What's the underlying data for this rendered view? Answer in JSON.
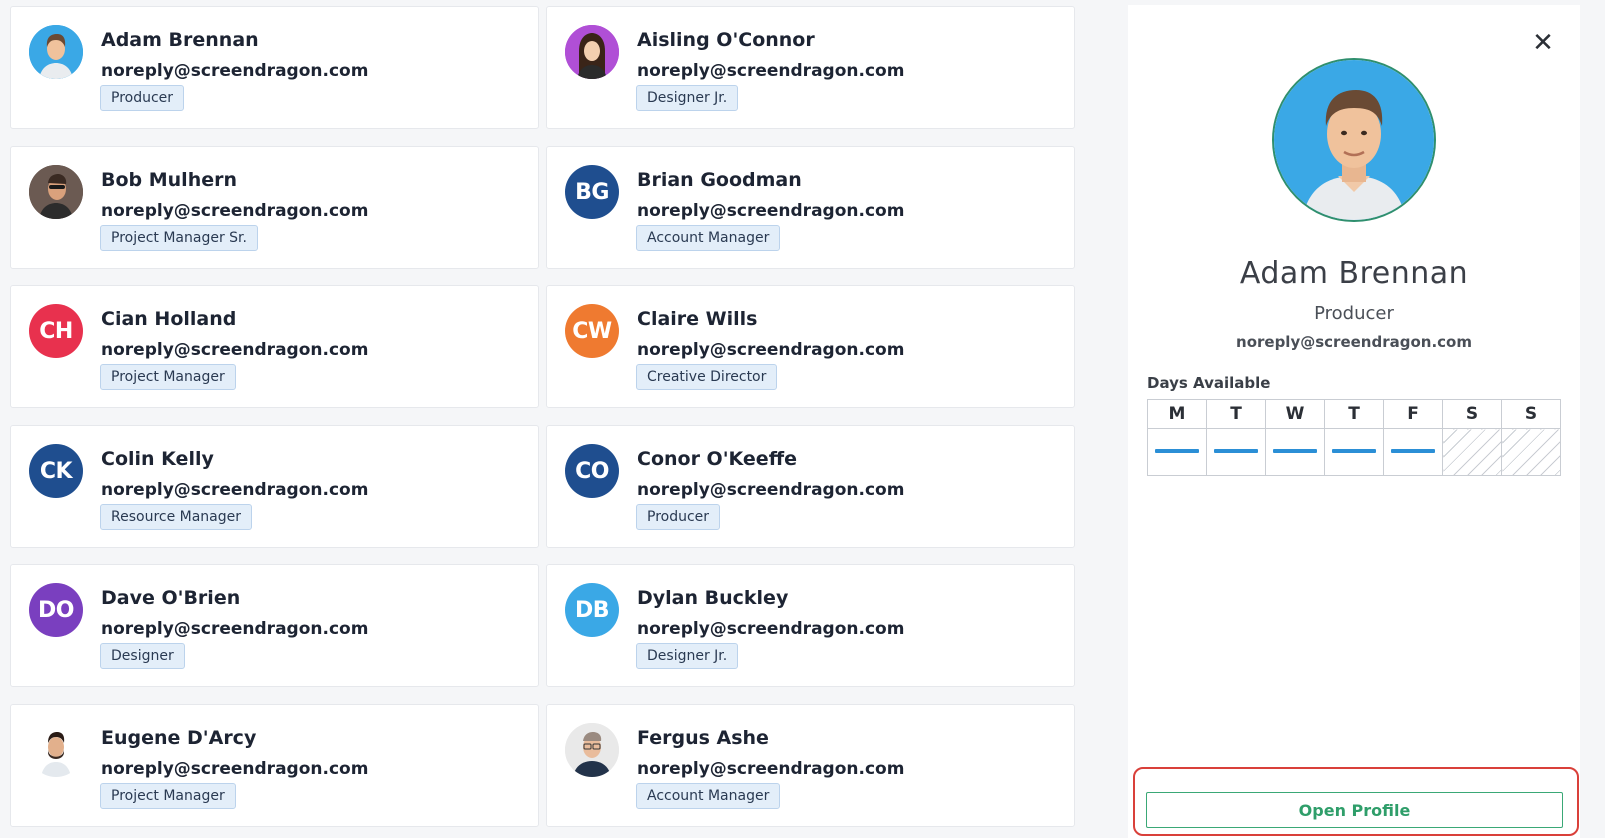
{
  "people": [
    {
      "name": "Adam Brennan",
      "email": "noreply@screendragon.com",
      "role": "Producer",
      "initials": "",
      "avatar_color": "#3aa8e6",
      "avatar_type": "photo"
    },
    {
      "name": "Aisling O'Connor",
      "email": "noreply@screendragon.com",
      "role": "Designer Jr.",
      "initials": "",
      "avatar_color": "#b04fd6",
      "avatar_type": "photo"
    },
    {
      "name": "Bob Mulhern",
      "email": "noreply@screendragon.com",
      "role": "Project Manager Sr.",
      "initials": "",
      "avatar_color": "#5a4a44",
      "avatar_type": "photo"
    },
    {
      "name": "Brian Goodman",
      "email": "noreply@screendragon.com",
      "role": "Account Manager",
      "initials": "BG",
      "avatar_color": "#1f4e8f",
      "avatar_type": "initials"
    },
    {
      "name": "Cian Holland",
      "email": "noreply@screendragon.com",
      "role": "Project Manager",
      "initials": "CH",
      "avatar_color": "#e8314e",
      "avatar_type": "initials"
    },
    {
      "name": "Claire Wills",
      "email": "noreply@screendragon.com",
      "role": "Creative Director",
      "initials": "CW",
      "avatar_color": "#ef7a30",
      "avatar_type": "initials"
    },
    {
      "name": "Colin Kelly",
      "email": "noreply@screendragon.com",
      "role": "Resource Manager",
      "initials": "CK",
      "avatar_color": "#1f4e8f",
      "avatar_type": "initials"
    },
    {
      "name": "Conor O'Keeffe",
      "email": "noreply@screendragon.com",
      "role": "Producer",
      "initials": "CO",
      "avatar_color": "#1f4e8f",
      "avatar_type": "initials"
    },
    {
      "name": "Dave O'Brien",
      "email": "noreply@screendragon.com",
      "role": "Designer",
      "initials": "DO",
      "avatar_color": "#7a3fbf",
      "avatar_type": "initials"
    },
    {
      "name": "Dylan Buckley",
      "email": "noreply@screendragon.com",
      "role": "Designer Jr.",
      "initials": "DB",
      "avatar_color": "#3aa8e6",
      "avatar_type": "initials"
    },
    {
      "name": "Eugene D'Arcy",
      "email": "noreply@screendragon.com",
      "role": "Project Manager",
      "initials": "",
      "avatar_color": "#ffffff",
      "avatar_type": "photo"
    },
    {
      "name": "Fergus Ashe",
      "email": "noreply@screendragon.com",
      "role": "Account Manager",
      "initials": "",
      "avatar_color": "#e9e9e9",
      "avatar_type": "photo"
    }
  ],
  "panel": {
    "close_icon": "close-icon",
    "name": "Adam Brennan",
    "role": "Producer",
    "email": "noreply@screendragon.com",
    "days_label": "Days Available",
    "days": [
      {
        "label": "M",
        "available": true
      },
      {
        "label": "T",
        "available": true
      },
      {
        "label": "W",
        "available": true
      },
      {
        "label": "T",
        "available": true
      },
      {
        "label": "F",
        "available": true
      },
      {
        "label": "S",
        "available": false
      },
      {
        "label": "S",
        "available": false
      }
    ],
    "open_profile_label": "Open Profile"
  },
  "colors": {
    "accent_green": "#2f9e6a",
    "highlight_red": "#d9403a",
    "availability_blue": "#2b8fd6"
  }
}
